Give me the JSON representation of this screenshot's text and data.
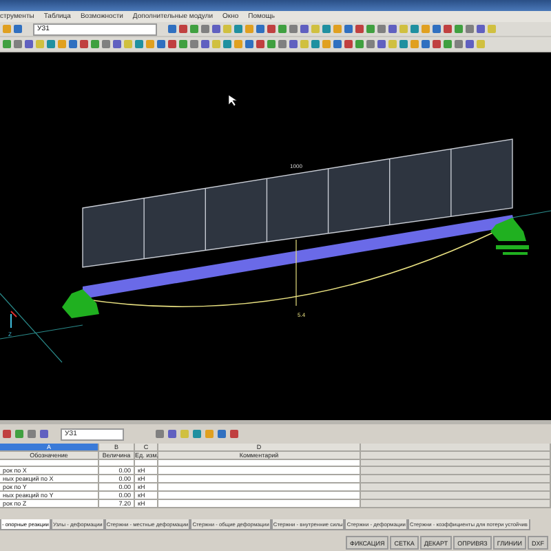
{
  "menu": [
    "струменты",
    "Таблица",
    "Возможности",
    "Дополнительные модули",
    "Окно",
    "Помощь"
  ],
  "toolbar": {
    "combo_value": "УЗ1"
  },
  "canvas": {
    "load_label": "1000",
    "deflection_label": "5.4",
    "axis_label": "Z"
  },
  "table": {
    "combo_value": "УЗ1",
    "column_letters": [
      {
        "label": "A",
        "selected": true
      },
      {
        "label": "B",
        "selected": false
      },
      {
        "label": "C",
        "selected": false
      },
      {
        "label": "D",
        "selected": false
      }
    ],
    "columns": [
      "Обозначение",
      "Величина",
      "Ед. изм.",
      "Комментарий"
    ],
    "rows": [
      {
        "name": "рок по  X",
        "value": "0.00",
        "unit": "кН"
      },
      {
        "name": "ных реакций по X",
        "value": "0.00",
        "unit": "кН"
      },
      {
        "name": "рок по  Y",
        "value": "0.00",
        "unit": "кН"
      },
      {
        "name": "ных реакций по Y",
        "value": "0.00",
        "unit": "кН"
      },
      {
        "name": "рок по  Z",
        "value": "7.20",
        "unit": "кН"
      }
    ]
  },
  "sheet_tabs": [
    {
      "label": "- опорные реакции",
      "selected": true
    },
    {
      "label": "Узлы - деформации",
      "selected": false
    },
    {
      "label": "Стержни - местные деформации",
      "selected": false
    },
    {
      "label": "Стержни - общие деформации",
      "selected": false
    },
    {
      "label": "Стержни - внутренние силы",
      "selected": false
    },
    {
      "label": "Стержни - деформации",
      "selected": false
    },
    {
      "label": "Стержни - коэффициенты для потери устойчив",
      "selected": false
    }
  ],
  "status_bar": [
    "ФИКСАЦИЯ",
    "СЕТКА",
    "ДЕКАРТ",
    "ОПРИВЯЗ",
    "ГЛИНИИ",
    "DXF"
  ]
}
